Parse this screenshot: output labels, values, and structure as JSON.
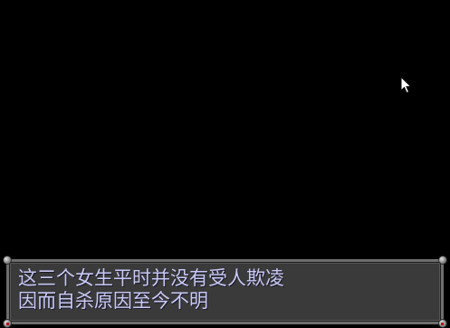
{
  "dialog": {
    "lines": [
      "这三个女生平时并没有受人欺凌",
      "因而自杀原因至今不明"
    ]
  },
  "icons": {
    "cursor": "mouse-pointer-icon",
    "frame_corner": "frame-rivet-icon"
  },
  "colors": {
    "background": "#000000",
    "dialog_fill": "#3a3a3a",
    "dialog_border": "#6e6e6e",
    "dialog_text": "#c8c8f4",
    "corner_accent": "#b01818"
  }
}
